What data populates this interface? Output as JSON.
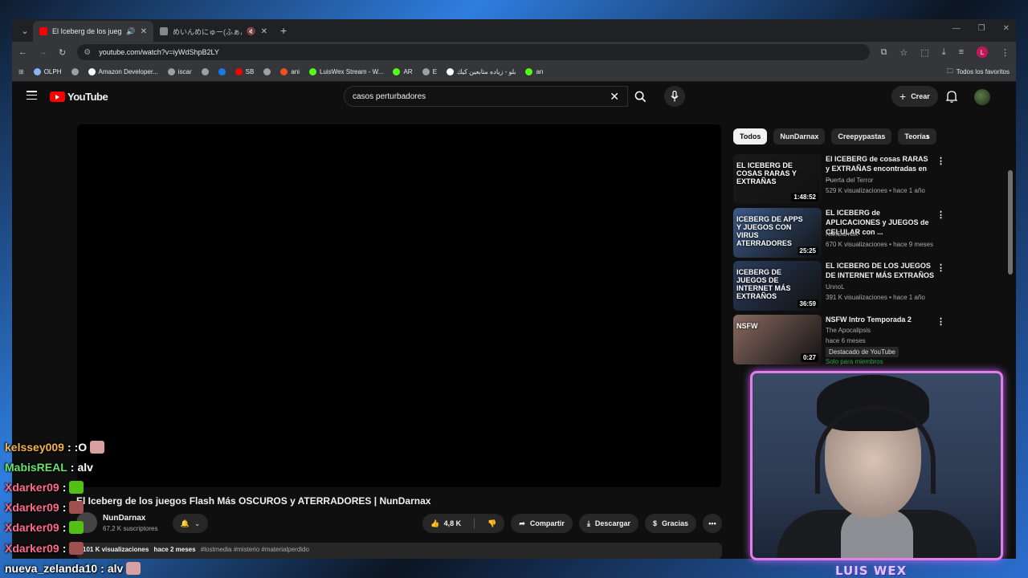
{
  "browser": {
    "tabs": [
      {
        "title": "El Iceberg de los juegos Fla",
        "active": true,
        "favicon_color": "#ff0000"
      },
      {
        "title": "めいんめにゅー(ふぁんしーあいら",
        "active": false,
        "favicon_color": "#888888"
      }
    ],
    "url": "youtube.com/watch?v=iyWdShpB2LY",
    "profile_initial": "L",
    "bookmarks": [
      {
        "label": "OLPH",
        "color": "#8ab4f8"
      },
      {
        "label": "",
        "color": "#9aa0a6"
      },
      {
        "label": "Amazon Developer...",
        "color": "#ffffff"
      },
      {
        "label": "iscar",
        "color": "#9aa0a6"
      },
      {
        "label": "",
        "color": "#9aa0a6"
      },
      {
        "label": "",
        "color": "#1877f2"
      },
      {
        "label": "SB",
        "color": "#ff0000"
      },
      {
        "label": "",
        "color": "#9aa0a6"
      },
      {
        "label": "ani",
        "color": "#f25022"
      },
      {
        "label": "LuisWex Stream - W...",
        "color": "#53fc18"
      },
      {
        "label": "AR",
        "color": "#53fc18"
      },
      {
        "label": "E",
        "color": "#9aa0a6"
      },
      {
        "label": "بلو - زياده متابعين كيك",
        "color": "#ffffff"
      },
      {
        "label": "an",
        "color": "#53fc18"
      }
    ],
    "all_bookmarks": "Todos los favoritos"
  },
  "youtube": {
    "logo_text": "YouTube",
    "search_value": "casos perturbadores",
    "create_label": "Crear",
    "video": {
      "title": "El Iceberg de los juegos Flash Más OSCUROS y ATERRADORES | NunDarnax",
      "channel": "NunDarnax",
      "subscribers": "67,2 K suscriptores",
      "likes": "4,8 K",
      "share": "Compartir",
      "download": "Descargar",
      "thanks": "Gracias",
      "views": "101 K visualizaciones",
      "age": "hace 2 meses",
      "tags": "#lostmedia #misterio #materialperdido"
    },
    "chips": [
      "Todos",
      "NunDarnax",
      "Creepypastas",
      "Teorías"
    ],
    "recommendations": [
      {
        "title": "El ICEBERG de cosas RARAS y EXTRAÑAS encontradas en ...",
        "channel": "Puerta del Terror",
        "meta": "529 K visualizaciones • hace 1 año",
        "duration": "1:48:52",
        "thumb_text": "EL ICEBERG DE COSAS RARAS Y EXTRAÑAS",
        "thumb_color": "#1a1a1a"
      },
      {
        "title": "EL ICEBERG de APLICACIONES y JUEGOS de CELULAR con ...",
        "channel": "NunDarnax",
        "meta": "670 K visualizaciones • hace 9 meses",
        "duration": "25:25",
        "thumb_text": "ICEBERG DE APPS Y JUEGOS CON VIRUS ATERRADORES",
        "thumb_color": "#3b5a8a"
      },
      {
        "title": "EL ICEBERG DE LOS JUEGOS DE INTERNET MÁS EXTRAÑOS",
        "channel": "UnnoL",
        "meta": "391 K visualizaciones • hace 1 año",
        "duration": "36:59",
        "thumb_text": "ICEBERG DE JUEGOS DE INTERNET MÁS EXTRAÑOS",
        "thumb_color": "#2a3b5c"
      },
      {
        "title": "NSFW Intro Temporada 2",
        "channel": "The Apocalipsis",
        "meta": "hace 6 meses",
        "duration": "0:27",
        "thumb_text": "NSFW",
        "thumb_color": "#8a6a60",
        "badge": "Destacado de YouTube",
        "members": "Solo para miembros"
      }
    ]
  },
  "stream": {
    "chat": [
      {
        "user": "kelssey009",
        "msg": ":O",
        "color": "#f5b342",
        "emote": "#d8a0a0"
      },
      {
        "user": "MabisREAL",
        "msg": "alv",
        "color": "#6be36b",
        "emote": ""
      },
      {
        "user": "Xdarker09",
        "msg": "",
        "color": "#ff6b8a",
        "emote": "#53c018"
      },
      {
        "user": "Xdarker09",
        "msg": "",
        "color": "#ff6b8a",
        "emote": "#a05050"
      },
      {
        "user": "Xdarker09",
        "msg": "",
        "color": "#ff6b8a",
        "emote": "#53c018"
      },
      {
        "user": "Xdarker09",
        "msg": "",
        "color": "#ff6b8a",
        "emote": "#a05050"
      },
      {
        "user": "nueva_zelanda10",
        "msg": "alv",
        "color": "#ffffff",
        "emote": "#d8a0a0"
      }
    ],
    "streamer_name": "LUIS WEX",
    "frame_color": "#e080e8"
  }
}
